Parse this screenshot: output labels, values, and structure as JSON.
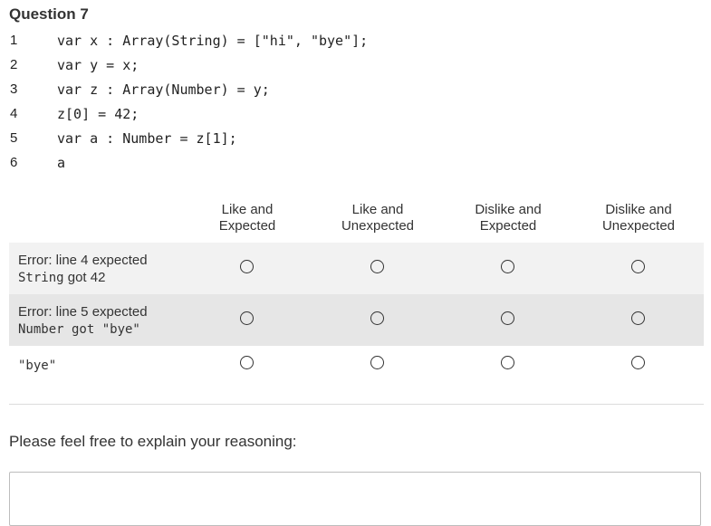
{
  "question": {
    "title": "Question 7",
    "code_lines": [
      {
        "num": "1",
        "text": "var x : Array(String) = [\"hi\", \"bye\"];"
      },
      {
        "num": "2",
        "text": "var y = x;"
      },
      {
        "num": "3",
        "text": "var z : Array(Number) = y;"
      },
      {
        "num": "4",
        "text": "z[0] = 42;"
      },
      {
        "num": "5",
        "text": "var a : Number = z[1];"
      },
      {
        "num": "6",
        "text": "a"
      }
    ]
  },
  "matrix": {
    "columns": [
      {
        "line1": "Like and",
        "line2": "Expected"
      },
      {
        "line1": "Like and",
        "line2": "Unexpected"
      },
      {
        "line1": "Dislike and",
        "line2": "Expected"
      },
      {
        "line1": "Dislike and",
        "line2": "Unexpected"
      }
    ],
    "rows": [
      {
        "label_text": "Error: line 4 expected",
        "label_code": "String",
        "label_tail": " got 42"
      },
      {
        "label_text": "Error: line 5 expected",
        "label_code": "Number",
        "label_tail": " got \"bye\""
      },
      {
        "label_code": "\"bye\""
      }
    ]
  },
  "reasoning": {
    "prompt": "Please feel free to explain your reasoning:",
    "value": ""
  }
}
